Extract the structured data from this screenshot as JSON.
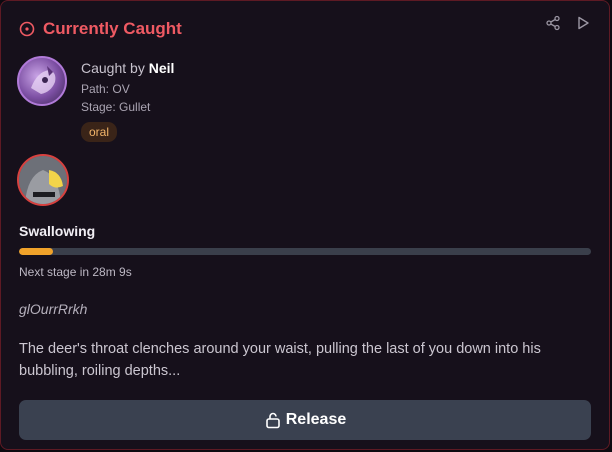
{
  "header": {
    "title": "Currently Caught",
    "icon": "circle-dot-icon",
    "actions": [
      "share-icon",
      "play-icon"
    ]
  },
  "predator": {
    "caught_by_prefix": "Caught by",
    "name": "Neil",
    "path": "Path: OV",
    "stage": "Stage: Gullet",
    "tag": "oral"
  },
  "stage": {
    "label": "Swallowing",
    "progress": 0.06,
    "next_stage": "Next stage in 28m 9s"
  },
  "sound": "glOurrRrkh",
  "description": "The deer's throat clenches around your waist, pulling the last of you down into his bubbling, roiling depths...",
  "release_button": {
    "label": "Release",
    "icon": "unlock-icon"
  },
  "colors": {
    "accent": "#ef5a63",
    "progress": "#f0a22a",
    "tag_text": "#f3b56a",
    "button_bg": "#3a4150"
  }
}
